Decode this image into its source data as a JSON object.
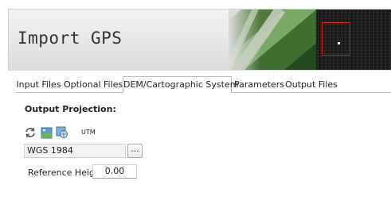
{
  "header": {
    "title": "Import GPS"
  },
  "tabs": [
    {
      "label": "Input Files",
      "active": false
    },
    {
      "label": "Optional Files",
      "active": false
    },
    {
      "label": "DEM/Cartographic System",
      "active": true
    },
    {
      "label": "Parameters",
      "active": false
    },
    {
      "label": "Output Files",
      "active": false
    }
  ],
  "projection": {
    "section_label": "Output Projection:",
    "toolbar": [
      {
        "icon": "refresh-icon"
      },
      {
        "icon": "map-icon"
      },
      {
        "icon": "globe-view-icon"
      },
      {
        "icon": "utm-icon",
        "label": "UTM"
      }
    ],
    "current_value": "WGS 1984",
    "browse_label": "..."
  },
  "reference_height": {
    "label": "Reference Height",
    "value": "0.00"
  },
  "colors": {
    "banner_highlight": "#e11c1c",
    "tab_border": "#bdbdbd"
  }
}
